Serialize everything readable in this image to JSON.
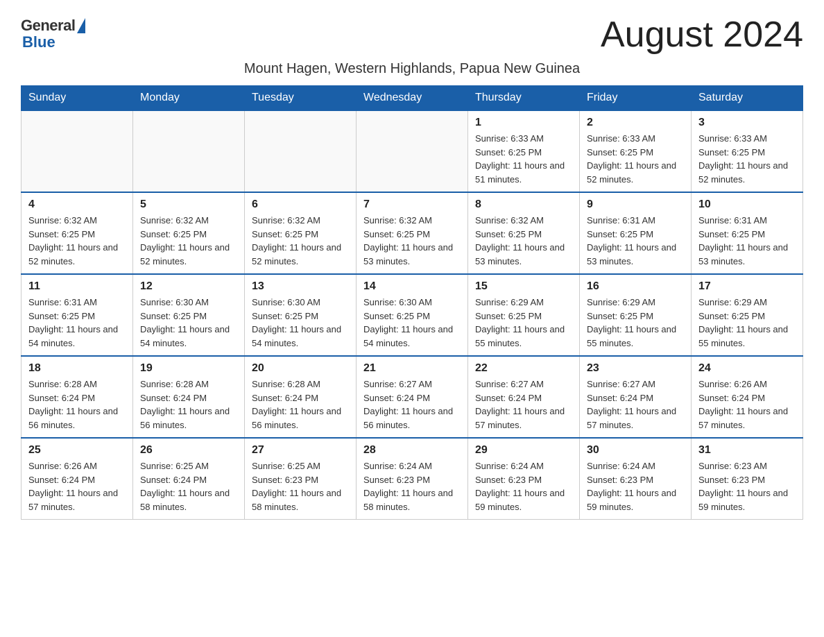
{
  "logo": {
    "general": "General",
    "blue": "Blue"
  },
  "header": {
    "month_title": "August 2024",
    "location": "Mount Hagen, Western Highlands, Papua New Guinea"
  },
  "weekdays": [
    "Sunday",
    "Monday",
    "Tuesday",
    "Wednesday",
    "Thursday",
    "Friday",
    "Saturday"
  ],
  "weeks": [
    [
      {
        "day": "",
        "sunrise": "",
        "sunset": "",
        "daylight": ""
      },
      {
        "day": "",
        "sunrise": "",
        "sunset": "",
        "daylight": ""
      },
      {
        "day": "",
        "sunrise": "",
        "sunset": "",
        "daylight": ""
      },
      {
        "day": "",
        "sunrise": "",
        "sunset": "",
        "daylight": ""
      },
      {
        "day": "1",
        "sunrise": "Sunrise: 6:33 AM",
        "sunset": "Sunset: 6:25 PM",
        "daylight": "Daylight: 11 hours and 51 minutes."
      },
      {
        "day": "2",
        "sunrise": "Sunrise: 6:33 AM",
        "sunset": "Sunset: 6:25 PM",
        "daylight": "Daylight: 11 hours and 52 minutes."
      },
      {
        "day": "3",
        "sunrise": "Sunrise: 6:33 AM",
        "sunset": "Sunset: 6:25 PM",
        "daylight": "Daylight: 11 hours and 52 minutes."
      }
    ],
    [
      {
        "day": "4",
        "sunrise": "Sunrise: 6:32 AM",
        "sunset": "Sunset: 6:25 PM",
        "daylight": "Daylight: 11 hours and 52 minutes."
      },
      {
        "day": "5",
        "sunrise": "Sunrise: 6:32 AM",
        "sunset": "Sunset: 6:25 PM",
        "daylight": "Daylight: 11 hours and 52 minutes."
      },
      {
        "day": "6",
        "sunrise": "Sunrise: 6:32 AM",
        "sunset": "Sunset: 6:25 PM",
        "daylight": "Daylight: 11 hours and 52 minutes."
      },
      {
        "day": "7",
        "sunrise": "Sunrise: 6:32 AM",
        "sunset": "Sunset: 6:25 PM",
        "daylight": "Daylight: 11 hours and 53 minutes."
      },
      {
        "day": "8",
        "sunrise": "Sunrise: 6:32 AM",
        "sunset": "Sunset: 6:25 PM",
        "daylight": "Daylight: 11 hours and 53 minutes."
      },
      {
        "day": "9",
        "sunrise": "Sunrise: 6:31 AM",
        "sunset": "Sunset: 6:25 PM",
        "daylight": "Daylight: 11 hours and 53 minutes."
      },
      {
        "day": "10",
        "sunrise": "Sunrise: 6:31 AM",
        "sunset": "Sunset: 6:25 PM",
        "daylight": "Daylight: 11 hours and 53 minutes."
      }
    ],
    [
      {
        "day": "11",
        "sunrise": "Sunrise: 6:31 AM",
        "sunset": "Sunset: 6:25 PM",
        "daylight": "Daylight: 11 hours and 54 minutes."
      },
      {
        "day": "12",
        "sunrise": "Sunrise: 6:30 AM",
        "sunset": "Sunset: 6:25 PM",
        "daylight": "Daylight: 11 hours and 54 minutes."
      },
      {
        "day": "13",
        "sunrise": "Sunrise: 6:30 AM",
        "sunset": "Sunset: 6:25 PM",
        "daylight": "Daylight: 11 hours and 54 minutes."
      },
      {
        "day": "14",
        "sunrise": "Sunrise: 6:30 AM",
        "sunset": "Sunset: 6:25 PM",
        "daylight": "Daylight: 11 hours and 54 minutes."
      },
      {
        "day": "15",
        "sunrise": "Sunrise: 6:29 AM",
        "sunset": "Sunset: 6:25 PM",
        "daylight": "Daylight: 11 hours and 55 minutes."
      },
      {
        "day": "16",
        "sunrise": "Sunrise: 6:29 AM",
        "sunset": "Sunset: 6:25 PM",
        "daylight": "Daylight: 11 hours and 55 minutes."
      },
      {
        "day": "17",
        "sunrise": "Sunrise: 6:29 AM",
        "sunset": "Sunset: 6:25 PM",
        "daylight": "Daylight: 11 hours and 55 minutes."
      }
    ],
    [
      {
        "day": "18",
        "sunrise": "Sunrise: 6:28 AM",
        "sunset": "Sunset: 6:24 PM",
        "daylight": "Daylight: 11 hours and 56 minutes."
      },
      {
        "day": "19",
        "sunrise": "Sunrise: 6:28 AM",
        "sunset": "Sunset: 6:24 PM",
        "daylight": "Daylight: 11 hours and 56 minutes."
      },
      {
        "day": "20",
        "sunrise": "Sunrise: 6:28 AM",
        "sunset": "Sunset: 6:24 PM",
        "daylight": "Daylight: 11 hours and 56 minutes."
      },
      {
        "day": "21",
        "sunrise": "Sunrise: 6:27 AM",
        "sunset": "Sunset: 6:24 PM",
        "daylight": "Daylight: 11 hours and 56 minutes."
      },
      {
        "day": "22",
        "sunrise": "Sunrise: 6:27 AM",
        "sunset": "Sunset: 6:24 PM",
        "daylight": "Daylight: 11 hours and 57 minutes."
      },
      {
        "day": "23",
        "sunrise": "Sunrise: 6:27 AM",
        "sunset": "Sunset: 6:24 PM",
        "daylight": "Daylight: 11 hours and 57 minutes."
      },
      {
        "day": "24",
        "sunrise": "Sunrise: 6:26 AM",
        "sunset": "Sunset: 6:24 PM",
        "daylight": "Daylight: 11 hours and 57 minutes."
      }
    ],
    [
      {
        "day": "25",
        "sunrise": "Sunrise: 6:26 AM",
        "sunset": "Sunset: 6:24 PM",
        "daylight": "Daylight: 11 hours and 57 minutes."
      },
      {
        "day": "26",
        "sunrise": "Sunrise: 6:25 AM",
        "sunset": "Sunset: 6:24 PM",
        "daylight": "Daylight: 11 hours and 58 minutes."
      },
      {
        "day": "27",
        "sunrise": "Sunrise: 6:25 AM",
        "sunset": "Sunset: 6:23 PM",
        "daylight": "Daylight: 11 hours and 58 minutes."
      },
      {
        "day": "28",
        "sunrise": "Sunrise: 6:24 AM",
        "sunset": "Sunset: 6:23 PM",
        "daylight": "Daylight: 11 hours and 58 minutes."
      },
      {
        "day": "29",
        "sunrise": "Sunrise: 6:24 AM",
        "sunset": "Sunset: 6:23 PM",
        "daylight": "Daylight: 11 hours and 59 minutes."
      },
      {
        "day": "30",
        "sunrise": "Sunrise: 6:24 AM",
        "sunset": "Sunset: 6:23 PM",
        "daylight": "Daylight: 11 hours and 59 minutes."
      },
      {
        "day": "31",
        "sunrise": "Sunrise: 6:23 AM",
        "sunset": "Sunset: 6:23 PM",
        "daylight": "Daylight: 11 hours and 59 minutes."
      }
    ]
  ]
}
